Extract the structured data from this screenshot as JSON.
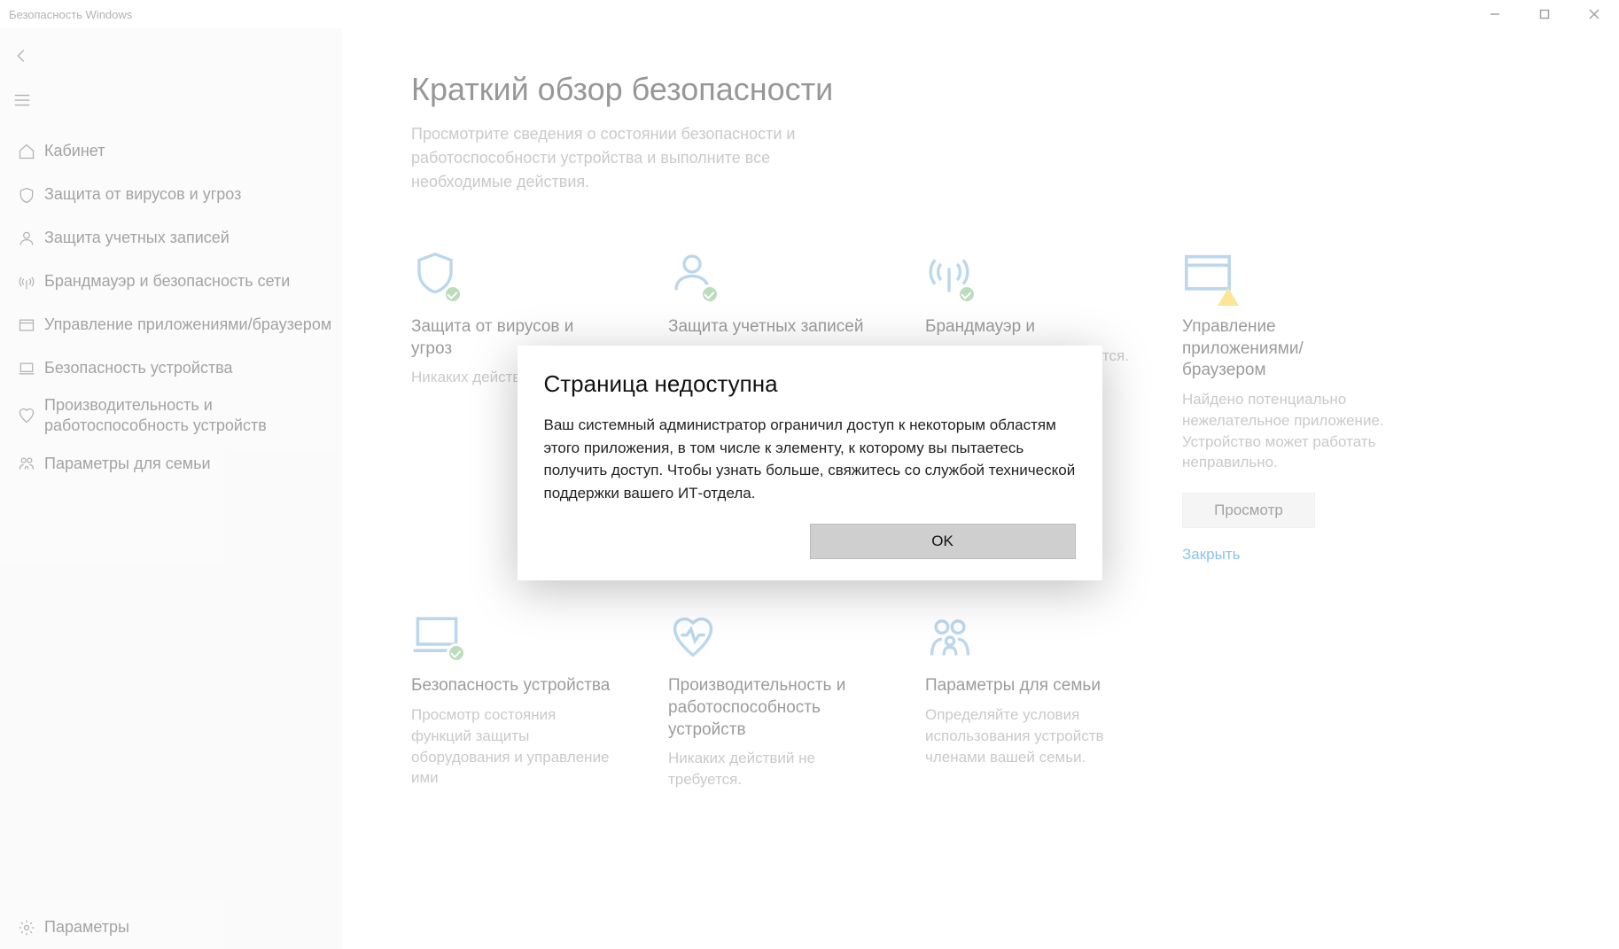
{
  "window": {
    "title": "Безопасность Windows"
  },
  "sidebar": {
    "items": [
      {
        "label": "Кабинет"
      },
      {
        "label": "Защита от вирусов и угроз"
      },
      {
        "label": "Защита учетных записей"
      },
      {
        "label": "Брандмауэр и безопасность сети"
      },
      {
        "label": "Управление приложениями/браузером"
      },
      {
        "label": "Безопасность устройства"
      },
      {
        "label": "Производительность и работоспособность устройств"
      },
      {
        "label": "Параметры для семьи"
      }
    ],
    "settings_label": "Параметры"
  },
  "page": {
    "title": "Краткий обзор безопасности",
    "subtitle": "Просмотрите сведения о состоянии безопасности и работоспособности устройства и выполните все необходимые действия."
  },
  "tiles": [
    {
      "title": "Защита от вирусов и угроз",
      "desc": "Никаких действ"
    },
    {
      "title": "Защита учетных записей",
      "desc": ""
    },
    {
      "title": "Брандмауэр и",
      "desc": "ебуется."
    },
    {
      "title": "Управление приложениями/браузером",
      "desc": "Найдено потенциально нежелательное приложение. Устройство может работать неправильно.",
      "button": "Просмотр",
      "link": "Закрыть"
    },
    {
      "title": "Безопасность устройства",
      "desc": "Просмотр состояния функций защиты оборудования и управление ими"
    },
    {
      "title": "Производительность и работоспособность устройств",
      "desc": "Никаких действий не требуется."
    },
    {
      "title": "Параметры для семьи",
      "desc": "Определяйте условия использования устройств членами вашей семьи."
    }
  ],
  "modal": {
    "title": "Страница недоступна",
    "body": "Ваш системный администратор ограничил доступ к некоторым областям этого приложения, в том числе к элементу, к которому вы пытаетесь получить доступ. Чтобы узнать больше, свяжитесь со службой технической поддержки вашего ИТ-отдела.",
    "ok": "OK"
  }
}
